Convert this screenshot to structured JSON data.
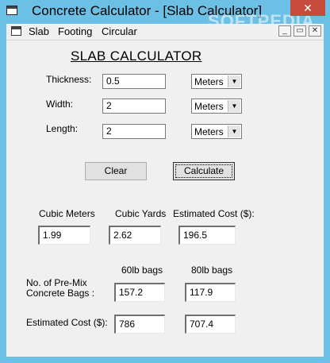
{
  "window": {
    "title": "Concrete Calculator - [Slab Calculator]",
    "close_glyph": "✕",
    "watermark": "SOFTPEDIA"
  },
  "menu": {
    "items": [
      "Slab",
      "Footing",
      "Circular"
    ],
    "mdi_buttons": [
      "_",
      "▭",
      "✕"
    ]
  },
  "slab": {
    "heading": "SLAB CALCULATOR",
    "fields": [
      {
        "label": "Thickness:",
        "value": "0.5",
        "unit": "Meters"
      },
      {
        "label": "Width:",
        "value": "2",
        "unit": "Meters"
      },
      {
        "label": "Length:",
        "value": "2",
        "unit": "Meters"
      }
    ],
    "buttons": {
      "clear": "Clear",
      "calculate": "Calculate"
    },
    "results": {
      "cubic_meters_label": "Cubic Meters",
      "cubic_meters": "1.99",
      "cubic_yards_label": "Cubic Yards",
      "cubic_yards": "2.62",
      "estimated_cost_label": "Estimated Cost ($):",
      "estimated_cost": "196.5"
    },
    "bags": {
      "header_60": "60lb bags",
      "header_80": "80lb bags",
      "count_label_1": "No. of Pre-Mix",
      "count_label_2": "Concrete Bags :",
      "count_60": "157.2",
      "count_80": "117.9",
      "cost_label": "Estimated Cost ($):",
      "cost_60": "786",
      "cost_80": "707.4"
    }
  }
}
